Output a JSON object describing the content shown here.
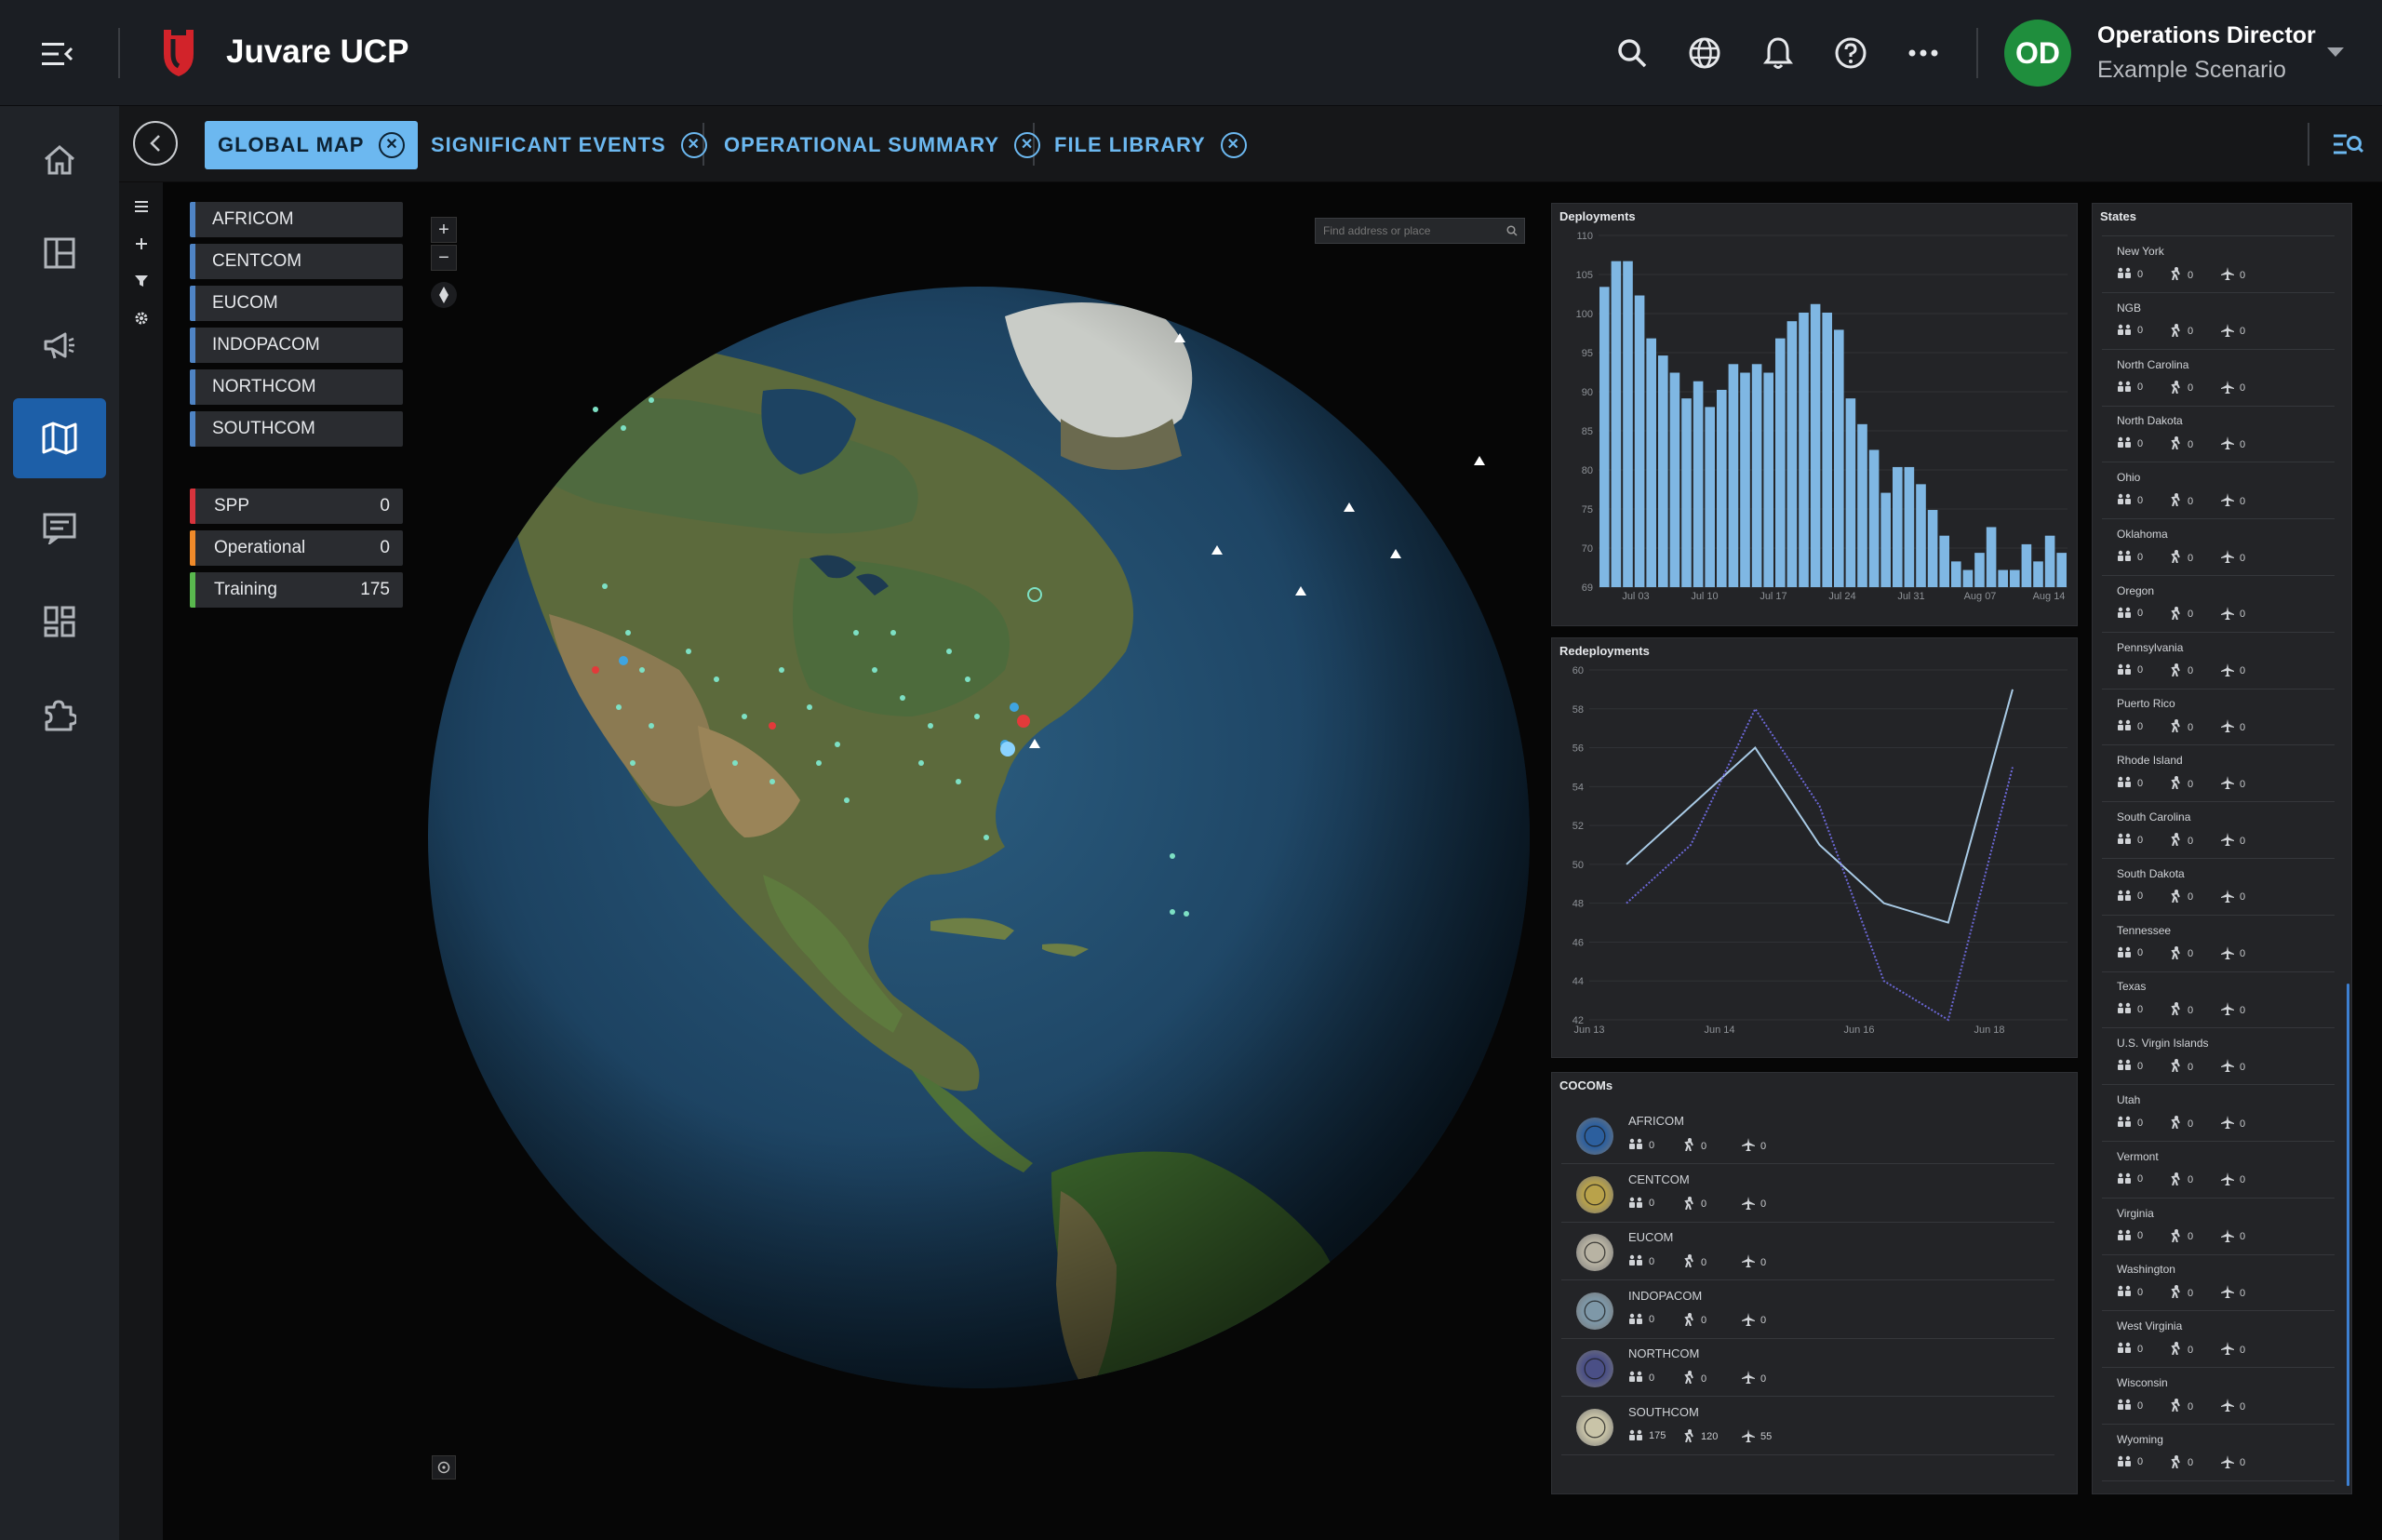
{
  "app": {
    "title": "Juvare UCP"
  },
  "user": {
    "initials": "OD",
    "name": "Operations Director",
    "scenario": "Example Scenario",
    "avatar_color": "#1f8e3d"
  },
  "tabs": [
    {
      "label": "GLOBAL MAP",
      "active": true
    },
    {
      "label": "SIGNIFICANT EVENTS",
      "active": false
    },
    {
      "label": "OPERATIONAL SUMMARY",
      "active": false
    },
    {
      "label": "FILE LIBRARY",
      "active": false
    }
  ],
  "map": {
    "search_placeholder": "Find address or place",
    "commands": [
      "AFRICOM",
      "CENTCOM",
      "EUCOM",
      "INDOPACOM",
      "NORTHCOM",
      "SOUTHCOM"
    ],
    "categories": [
      {
        "label": "SPP",
        "count": "0",
        "color": "#d7343d"
      },
      {
        "label": "Operational",
        "count": "0",
        "color": "#ef8a2a"
      },
      {
        "label": "Training",
        "count": "175",
        "color": "#59b84e"
      }
    ]
  },
  "deployments": {
    "title": "Deployments"
  },
  "redeployments": {
    "title": "Redeployments"
  },
  "chart_data": [
    {
      "type": "bar",
      "title": "Deployments",
      "ylim": [
        69,
        110
      ],
      "yticks": [
        "110",
        "105",
        "100",
        "95",
        "90",
        "85",
        "80",
        "75",
        "70",
        "69"
      ],
      "xticks": [
        "Jul 03",
        "Jul 10",
        "Jul 17",
        "Jul 24",
        "Jul 31",
        "Aug 07",
        "Aug 14"
      ],
      "values": [
        104,
        107,
        107,
        103,
        98,
        96,
        94,
        91,
        93,
        90,
        92,
        95,
        94,
        95,
        94,
        98,
        100,
        101,
        102,
        101,
        99,
        91,
        88,
        85,
        80,
        83,
        83,
        81,
        78,
        75,
        72,
        71,
        73,
        76,
        71,
        71,
        74,
        72,
        75,
        73
      ]
    },
    {
      "type": "line",
      "title": "Redeployments",
      "ylim": [
        42,
        60
      ],
      "yticks": [
        "60",
        "58",
        "56",
        "54",
        "52",
        "50",
        "48",
        "46",
        "44",
        "42"
      ],
      "xticks": [
        "Jun 13",
        "Jun 14",
        "Jun 16",
        "Jun 18"
      ],
      "series": [
        {
          "values": [
            50,
            53,
            56,
            51,
            48,
            47,
            59
          ],
          "color": "#a9cbe6",
          "style": "solid"
        },
        {
          "values": [
            48,
            51,
            58,
            53,
            44,
            42,
            55
          ],
          "color": "#6c68d8",
          "style": "dotted"
        }
      ]
    }
  ],
  "states": {
    "title": "States",
    "items": [
      {
        "name": "New York",
        "a": "0",
        "b": "0",
        "c": "0"
      },
      {
        "name": "NGB",
        "a": "0",
        "b": "0",
        "c": "0"
      },
      {
        "name": "North Carolina",
        "a": "0",
        "b": "0",
        "c": "0"
      },
      {
        "name": "North Dakota",
        "a": "0",
        "b": "0",
        "c": "0"
      },
      {
        "name": "Ohio",
        "a": "0",
        "b": "0",
        "c": "0"
      },
      {
        "name": "Oklahoma",
        "a": "0",
        "b": "0",
        "c": "0"
      },
      {
        "name": "Oregon",
        "a": "0",
        "b": "0",
        "c": "0"
      },
      {
        "name": "Pennsylvania",
        "a": "0",
        "b": "0",
        "c": "0"
      },
      {
        "name": "Puerto Rico",
        "a": "0",
        "b": "0",
        "c": "0"
      },
      {
        "name": "Rhode Island",
        "a": "0",
        "b": "0",
        "c": "0"
      },
      {
        "name": "South Carolina",
        "a": "0",
        "b": "0",
        "c": "0"
      },
      {
        "name": "South Dakota",
        "a": "0",
        "b": "0",
        "c": "0"
      },
      {
        "name": "Tennessee",
        "a": "0",
        "b": "0",
        "c": "0"
      },
      {
        "name": "Texas",
        "a": "0",
        "b": "0",
        "c": "0"
      },
      {
        "name": "U.S. Virgin Islands",
        "a": "0",
        "b": "0",
        "c": "0"
      },
      {
        "name": "Utah",
        "a": "0",
        "b": "0",
        "c": "0"
      },
      {
        "name": "Vermont",
        "a": "0",
        "b": "0",
        "c": "0"
      },
      {
        "name": "Virginia",
        "a": "0",
        "b": "0",
        "c": "0"
      },
      {
        "name": "Washington",
        "a": "0",
        "b": "0",
        "c": "0"
      },
      {
        "name": "West Virginia",
        "a": "0",
        "b": "0",
        "c": "0"
      },
      {
        "name": "Wisconsin",
        "a": "0",
        "b": "0",
        "c": "0"
      },
      {
        "name": "Wyoming",
        "a": "0",
        "b": "0",
        "c": "0"
      }
    ]
  },
  "cocoms": {
    "title": "COCOMs",
    "items": [
      {
        "name": "AFRICOM",
        "a": "0",
        "b": "0",
        "c": "0",
        "seal": "#2c5f9e"
      },
      {
        "name": "CENTCOM",
        "a": "0",
        "b": "0",
        "c": "0",
        "seal": "#b9a24a"
      },
      {
        "name": "EUCOM",
        "a": "0",
        "b": "0",
        "c": "0",
        "seal": "#b8b3a3"
      },
      {
        "name": "INDOPACOM",
        "a": "0",
        "b": "0",
        "c": "0",
        "seal": "#7e98a8"
      },
      {
        "name": "NORTHCOM",
        "a": "0",
        "b": "0",
        "c": "0",
        "seal": "#4a4f86"
      },
      {
        "name": "SOUTHCOM",
        "a": "175",
        "b": "120",
        "c": "55",
        "seal": "#c9c4a8"
      }
    ]
  }
}
